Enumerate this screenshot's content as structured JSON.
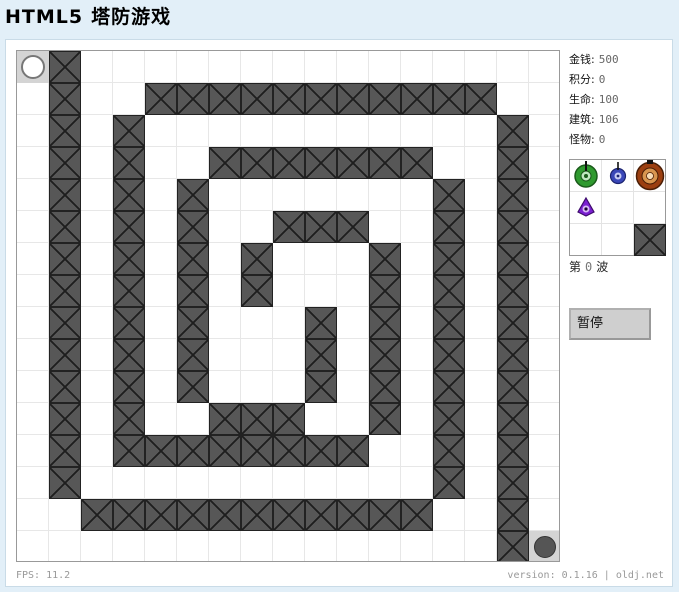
{
  "header": {
    "title_en": "HTML5",
    "title_cn": "塔防游戏"
  },
  "stats": [
    {
      "key": "money",
      "label": "金钱:",
      "value": "500"
    },
    {
      "key": "score",
      "label": "积分:",
      "value": "0"
    },
    {
      "key": "life",
      "label": "生命:",
      "value": "100"
    },
    {
      "key": "building",
      "label": "建筑:",
      "value": "106"
    },
    {
      "key": "monster",
      "label": "怪物:",
      "value": "0"
    }
  ],
  "wave": {
    "prefix": "第",
    "number": "0",
    "suffix": "波"
  },
  "pause_label": "暂停",
  "footer": {
    "fps": "FPS: 11.2",
    "version": "version: 0.1.16",
    "separator": "|",
    "site": "oldj.net"
  },
  "map": {
    "columns": 17,
    "rows": 16,
    "start": "top-left",
    "end": "bottom-right",
    "walls": [
      [
        1,
        0
      ],
      [
        1,
        1
      ],
      [
        1,
        2
      ],
      [
        1,
        3
      ],
      [
        1,
        4
      ],
      [
        1,
        5
      ],
      [
        1,
        6
      ],
      [
        1,
        7
      ],
      [
        1,
        8
      ],
      [
        1,
        9
      ],
      [
        1,
        10
      ],
      [
        1,
        11
      ],
      [
        1,
        12
      ],
      [
        1,
        13
      ],
      [
        4,
        1
      ],
      [
        5,
        1
      ],
      [
        6,
        1
      ],
      [
        7,
        1
      ],
      [
        8,
        1
      ],
      [
        9,
        1
      ],
      [
        10,
        1
      ],
      [
        11,
        1
      ],
      [
        12,
        1
      ],
      [
        13,
        1
      ],
      [
        14,
        1
      ],
      [
        15,
        2
      ],
      [
        15,
        3
      ],
      [
        15,
        4
      ],
      [
        15,
        5
      ],
      [
        15,
        6
      ],
      [
        15,
        7
      ],
      [
        15,
        8
      ],
      [
        15,
        9
      ],
      [
        15,
        10
      ],
      [
        15,
        11
      ],
      [
        15,
        12
      ],
      [
        15,
        13
      ],
      [
        15,
        14
      ],
      [
        15,
        15
      ],
      [
        2,
        14
      ],
      [
        3,
        14
      ],
      [
        4,
        14
      ],
      [
        5,
        14
      ],
      [
        6,
        14
      ],
      [
        7,
        14
      ],
      [
        8,
        14
      ],
      [
        9,
        14
      ],
      [
        10,
        14
      ],
      [
        11,
        14
      ],
      [
        12,
        14
      ],
      [
        3,
        2
      ],
      [
        3,
        3
      ],
      [
        3,
        4
      ],
      [
        3,
        5
      ],
      [
        3,
        6
      ],
      [
        3,
        7
      ],
      [
        3,
        8
      ],
      [
        3,
        9
      ],
      [
        3,
        10
      ],
      [
        3,
        11
      ],
      [
        3,
        12
      ],
      [
        6,
        3
      ],
      [
        7,
        3
      ],
      [
        8,
        3
      ],
      [
        9,
        3
      ],
      [
        10,
        3
      ],
      [
        11,
        3
      ],
      [
        12,
        3
      ],
      [
        13,
        4
      ],
      [
        13,
        5
      ],
      [
        13,
        6
      ],
      [
        13,
        7
      ],
      [
        13,
        8
      ],
      [
        13,
        9
      ],
      [
        13,
        10
      ],
      [
        13,
        11
      ],
      [
        13,
        12
      ],
      [
        13,
        13
      ],
      [
        4,
        12
      ],
      [
        5,
        12
      ],
      [
        6,
        12
      ],
      [
        7,
        12
      ],
      [
        8,
        12
      ],
      [
        9,
        12
      ],
      [
        10,
        12
      ],
      [
        5,
        4
      ],
      [
        5,
        5
      ],
      [
        5,
        6
      ],
      [
        5,
        7
      ],
      [
        5,
        8
      ],
      [
        5,
        9
      ],
      [
        5,
        10
      ],
      [
        8,
        5
      ],
      [
        9,
        5
      ],
      [
        10,
        5
      ],
      [
        11,
        6
      ],
      [
        11,
        7
      ],
      [
        11,
        8
      ],
      [
        11,
        9
      ],
      [
        11,
        10
      ],
      [
        11,
        11
      ],
      [
        6,
        11
      ],
      [
        7,
        11
      ],
      [
        8,
        11
      ],
      [
        7,
        6
      ],
      [
        7,
        7
      ],
      [
        9,
        8
      ],
      [
        9,
        9
      ],
      [
        9,
        10
      ]
    ]
  },
  "shop": {
    "items": [
      {
        "name": "green-cannon-tower",
        "color": "#2f9a2f"
      },
      {
        "name": "blue-laser-tower",
        "color": "#3a47b8"
      },
      {
        "name": "orange-heavy-tower",
        "color": "#b35a1b"
      },
      {
        "name": "purple-eye-tower",
        "color": "#7a1fd1"
      },
      {
        "name": "wall-block",
        "color": "#575757"
      }
    ]
  }
}
